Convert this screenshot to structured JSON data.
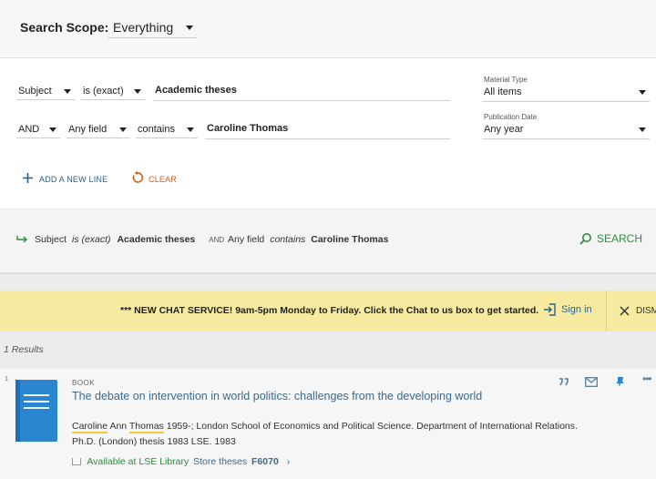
{
  "scope": {
    "label": "Search Scope:",
    "value": "Everything"
  },
  "advanced": {
    "rows": [
      {
        "operator": "",
        "field": "Subject",
        "condition": "is (exact)",
        "value": "Academic theses"
      },
      {
        "operator": "AND",
        "field": "Any field",
        "condition": "contains",
        "value": "Caroline Thomas"
      }
    ],
    "material_type": {
      "label": "Material Type",
      "value": "All items"
    },
    "publication_date": {
      "label": "Publication Date",
      "value": "Any year"
    },
    "add_line_label": "ADD A NEW LINE",
    "clear_label": "CLEAR"
  },
  "summary": {
    "field1": "Subject",
    "cond1": "is (exact)",
    "val1": "Academic theses",
    "op2": "AND",
    "field2": "Any field",
    "cond2": "contains",
    "val2": "Caroline Thomas",
    "search_label": "SEARCH"
  },
  "banner": {
    "text": "*** NEW CHAT SERVICE! 9am-5pm Monday to Friday. Click the Chat to us box to get started.",
    "signin_label": "Sign in",
    "dismiss_label": "DISM"
  },
  "results": {
    "count_text": "1 Results",
    "items": [
      {
        "index": "1",
        "type": "BOOK",
        "title": "The debate on intervention in world politics: challenges from the developing world",
        "author_first": "Caroline",
        "author_mid": "Ann",
        "author_last": "Thomas",
        "author_rest": "1959-; London School of Economics and Political Science. Department of International Relations.",
        "publication": "Ph.D. (London) thesis 1983 LSE. 1983",
        "availability": "Available at LSE Library",
        "location": "Store theses",
        "call_number": "F6070"
      }
    ]
  },
  "colors": {
    "accent_blue": "#3d6a8b",
    "link_blue": "#2f5f8a",
    "clear_orange": "#c9621e",
    "search_green": "#2e8b3e",
    "banner_yellow": "#f7eba1",
    "book_blue": "#2a86d1"
  }
}
